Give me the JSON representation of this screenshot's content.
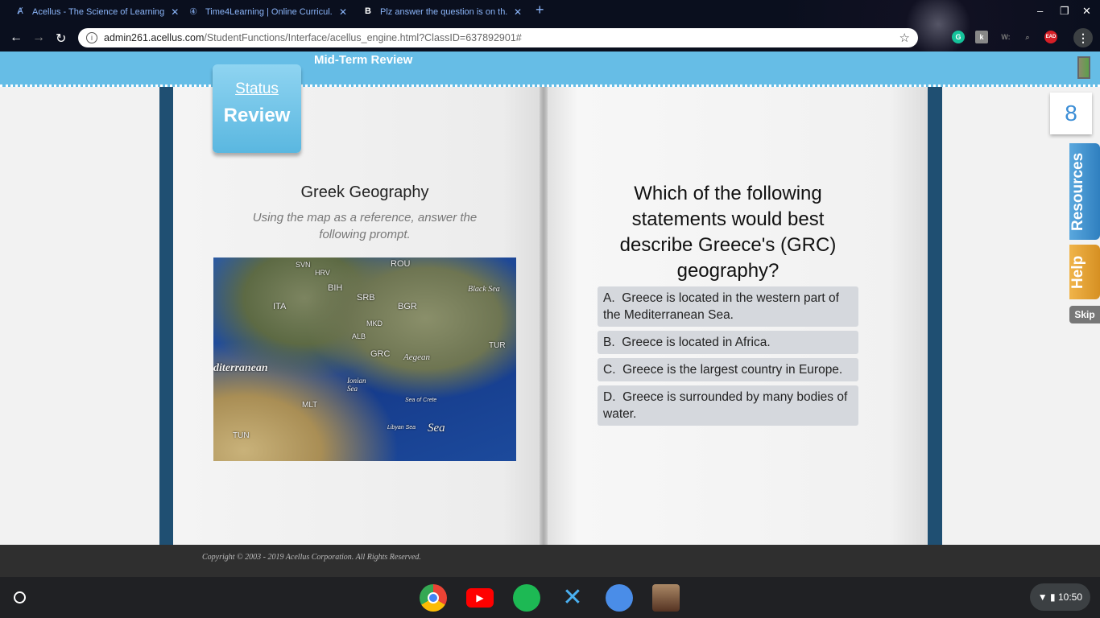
{
  "browser": {
    "tabs": [
      {
        "label": "Acellus - The Science of Learning",
        "icon": "acellus-icon"
      },
      {
        "label": "Time4Learning | Online Curricul...",
        "icon": "time4learning-icon"
      },
      {
        "label": "Plz answer the question is on th...",
        "icon": "brainly-icon"
      }
    ],
    "url_host": "admin261.acellus.com",
    "url_path": "/StudentFunctions/Interface/acellus_engine.html?ClassID=637892901#",
    "extensions": [
      {
        "name": "grammarly-icon",
        "label": "G",
        "color": "#15c39a"
      },
      {
        "name": "extension-k-icon",
        "label": "k",
        "color": "#888888"
      },
      {
        "name": "extension-w-icon",
        "label": "W:",
        "color": "#444444"
      },
      {
        "name": "extension-search-icon",
        "label": "⌕",
        "color": "#444444"
      },
      {
        "name": "extension-ead-icon",
        "label": "EAD",
        "color": "#d61f26"
      }
    ]
  },
  "header": {
    "title": "Mid-Term Review",
    "exit_icon": "exit-door-icon"
  },
  "status_badge": {
    "line1": "Status",
    "line2": "Review"
  },
  "lesson": {
    "title": "Greek Geography",
    "subtitle": "Using the map as a reference, answer the following prompt.",
    "map_labels": [
      "SVN",
      "HRV",
      "ROU",
      "BIH",
      "SRB",
      "Black Sea",
      "ITA",
      "BGR",
      "MKD",
      "ALB",
      "TUR",
      "GRC",
      "Aegean",
      "diterranean",
      "Ionian Sea",
      "Sea",
      "MLT",
      "TUN",
      "Libyan Sea",
      "Sea of Crete"
    ]
  },
  "question": {
    "text": "Which of the following statements would best describe Greece's (GRC) geography?",
    "options": [
      {
        "letter": "A.",
        "text": "Greece is located in the western part of the Mediterranean Sea."
      },
      {
        "letter": "B.",
        "text": "Greece is located in Africa."
      },
      {
        "letter": "C.",
        "text": "Greece is the largest country in Europe."
      },
      {
        "letter": "D.",
        "text": "Greece is surrounded by many bodies of water."
      }
    ]
  },
  "sidebar": {
    "count": "8",
    "resources": "Resources",
    "help": "Help",
    "skip": "Skip"
  },
  "footer": {
    "copyright": "Copyright © 2003 - 2019 Acellus Corporation.  All Rights Reserved."
  },
  "shelf": {
    "time": "10:50",
    "apps": [
      "chrome-icon",
      "youtube-icon",
      "spotify-icon",
      "acellus-app-icon",
      "palette-icon",
      "game-icon"
    ]
  }
}
